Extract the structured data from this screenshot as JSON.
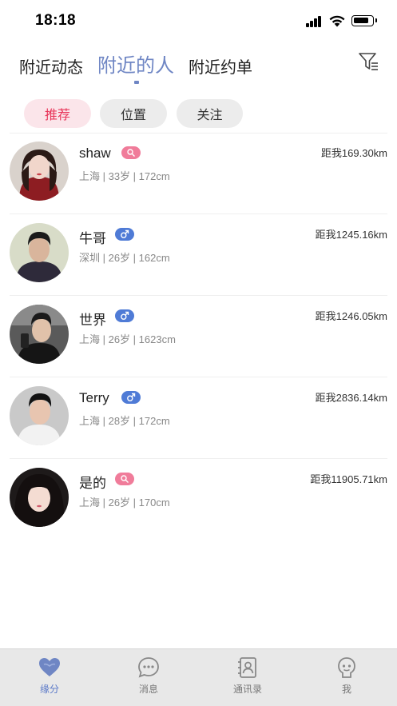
{
  "status_bar": {
    "time": "18:18"
  },
  "top_tabs": [
    {
      "label": "附近动态",
      "active": false
    },
    {
      "label": "附近的人",
      "active": true
    },
    {
      "label": "附近约单",
      "active": false
    }
  ],
  "filter_icon": "filter-icon",
  "chips": [
    {
      "label": "推荐",
      "active": true
    },
    {
      "label": "位置",
      "active": false
    },
    {
      "label": "关注",
      "active": false
    }
  ],
  "users": [
    {
      "name": "shaw",
      "gender": "female",
      "meta": "上海 | 33岁 | 172cm",
      "distance": "距我169.30km"
    },
    {
      "name": "牛哥",
      "gender": "male",
      "meta": "深圳 | 26岁 | 162cm",
      "distance": "距我1245.16km"
    },
    {
      "name": "世界",
      "gender": "male",
      "meta": "上海 | 26岁 | 1623cm",
      "distance": "距我1246.05km"
    },
    {
      "name": "Terry",
      "gender": "male",
      "meta": "上海 | 28岁 | 172cm",
      "distance": "距我2836.14km"
    },
    {
      "name": "是的",
      "gender": "female",
      "meta": "上海 | 26岁 | 170cm",
      "distance": "距我11905.71km"
    }
  ],
  "bottom_nav": [
    {
      "label": "缘分",
      "icon": "heart-icon",
      "active": true
    },
    {
      "label": "消息",
      "icon": "chat-bubble-icon",
      "active": false
    },
    {
      "label": "通讯录",
      "icon": "contacts-book-icon",
      "active": false
    },
    {
      "label": "我",
      "icon": "profile-face-icon",
      "active": false
    }
  ],
  "colors": {
    "accent": "#6f86c4",
    "chip_active_bg": "#fbe5ea",
    "chip_active_text": "#e8365a",
    "female_badge": "#f07c9a",
    "male_badge": "#4f7bd6",
    "nav_bg": "#e8e8e8"
  }
}
